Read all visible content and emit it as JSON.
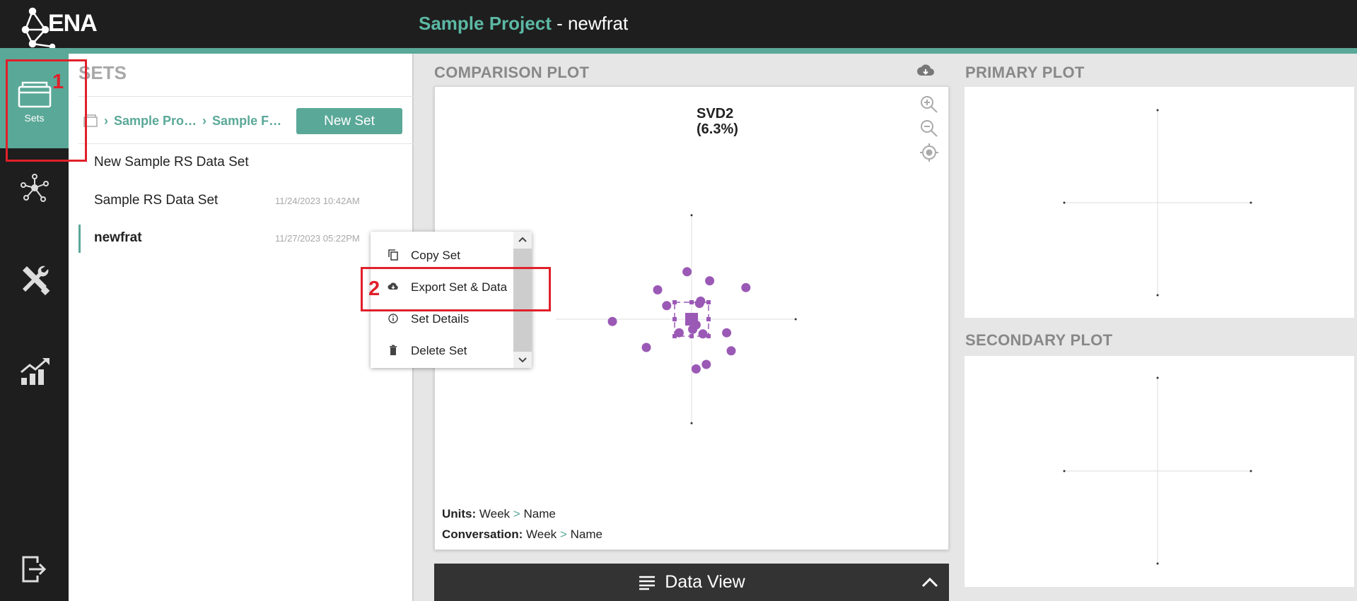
{
  "app": {
    "logo_text": "ENA",
    "project_name": "Sample Project",
    "separator": " - ",
    "set_name": "newfrat",
    "colors": {
      "accent": "#5aa898",
      "header": "#1e1e1e",
      "point": "#9b59b6",
      "annotation": "#e0202a"
    }
  },
  "rail": {
    "items": [
      {
        "name": "sets",
        "label": "Sets",
        "icon": "folder-icon",
        "active": true
      },
      {
        "name": "network",
        "label": "",
        "icon": "network-icon"
      },
      {
        "name": "tools",
        "label": "",
        "icon": "tools-icon"
      },
      {
        "name": "results",
        "label": "",
        "icon": "chart-icon"
      },
      {
        "name": "exit",
        "label": "",
        "icon": "exit-icon"
      }
    ]
  },
  "sets_panel": {
    "title": "SETS",
    "breadcrumb": [
      "Sample Pro…",
      "Sample F…"
    ],
    "new_set_label": "New Set",
    "sets": [
      {
        "name": "New Sample RS Data Set",
        "date": ""
      },
      {
        "name": "Sample RS Data Set",
        "date": "11/24/2023 10:42AM"
      },
      {
        "name": "newfrat",
        "date": "11/27/2023 05:22PM",
        "selected": true
      }
    ]
  },
  "context_menu": {
    "items": [
      {
        "label": "Copy Set",
        "icon": "copy-icon"
      },
      {
        "label": "Export Set & Data",
        "icon": "cloud-download-icon"
      },
      {
        "label": "Set Details",
        "icon": "info-icon"
      },
      {
        "label": "Delete Set",
        "icon": "trash-icon"
      }
    ]
  },
  "annotations": {
    "step1": "1",
    "step2": "2"
  },
  "comparison_plot": {
    "title": "COMPARISON PLOT",
    "y_axis_label_line1": "SVD2",
    "y_axis_label_line2": "(6.3%)",
    "units_label": "Units:",
    "units_path": [
      "Week",
      "Name"
    ],
    "conversation_label": "Conversation:",
    "conversation_path": [
      "Week",
      "Name"
    ]
  },
  "chart_data": {
    "type": "scatter",
    "ylabel": "SVD2 (6.3%)",
    "points": [
      {
        "x": -0.2,
        "y": 2.1
      },
      {
        "x": 0.8,
        "y": 1.7
      },
      {
        "x": 2.4,
        "y": 1.4
      },
      {
        "x": -1.5,
        "y": 1.3
      },
      {
        "x": 0.4,
        "y": 0.8
      },
      {
        "x": 0.35,
        "y": 0.7
      },
      {
        "x": -1.1,
        "y": 0.6
      },
      {
        "x": -3.5,
        "y": -0.1
      },
      {
        "x": 0.2,
        "y": -0.25
      },
      {
        "x": 0.05,
        "y": -0.45
      },
      {
        "x": -0.55,
        "y": -0.6
      },
      {
        "x": 0.5,
        "y": -0.65
      },
      {
        "x": 1.55,
        "y": -0.6
      },
      {
        "x": -2.0,
        "y": -1.25
      },
      {
        "x": 1.75,
        "y": -1.4
      },
      {
        "x": 0.65,
        "y": -2.0
      },
      {
        "x": 0.2,
        "y": -2.2
      }
    ],
    "means": [
      {
        "x": 0.0,
        "y": 0.0
      }
    ],
    "confidence_box": {
      "x": [
        -0.75,
        0.75
      ],
      "y": [
        -0.75,
        0.75
      ]
    },
    "xlim": [
      -6.0,
      4.6
    ],
    "ylim": [
      -4.6,
      4.6
    ]
  },
  "data_view": {
    "label": "Data View"
  },
  "primary_plot": {
    "title": "PRIMARY PLOT"
  },
  "secondary_plot": {
    "title": "SECONDARY PLOT"
  }
}
